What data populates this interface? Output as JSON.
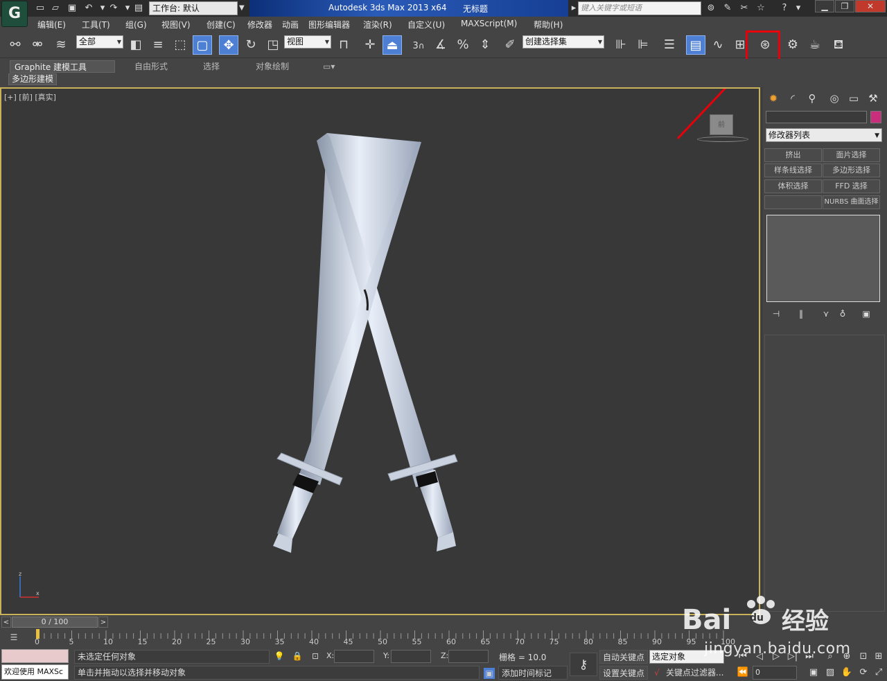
{
  "titlebar": {
    "app_logo": "G",
    "workspace": "工作台: 默认",
    "app_title": "Autodesk 3ds Max  2013 x64",
    "doc_title": "无标题",
    "search_placeholder": "键入关键字或短语",
    "icons": [
      "new-file-icon",
      "open-file-icon",
      "save-icon",
      "undo-icon",
      "redo-icon",
      "project-folder-icon"
    ]
  },
  "menu": {
    "items": [
      "编辑(E)",
      "工具(T)",
      "组(G)",
      "视图(V)",
      "创建(C)",
      "修改器",
      "动画",
      "图形编辑器",
      "渲染(R)",
      "自定义(U)",
      "MAXScript(M)",
      "帮助(H)"
    ]
  },
  "toolbar": {
    "selection_filter": "全部",
    "ref_coord": "视图",
    "snap_3": "3",
    "named_selection": "创建选择集",
    "highlighted_tool": "render-setup-icon"
  },
  "ribbon": {
    "tabs": [
      "Graphite 建模工具",
      "自由形式",
      "选择",
      "对象绘制"
    ],
    "sub_label": "多边形建模"
  },
  "viewport": {
    "label": "[+] [前] [真实]",
    "viewcube_label": "前",
    "background": "#383838",
    "border_color": "#c9b25a",
    "annotation_color": "#e8000a"
  },
  "command_panel": {
    "modifier_list": "修改器列表",
    "object_color": "#c92d7c",
    "buttons": [
      "挤出",
      "面片选择",
      "样条线选择",
      "多边形选择",
      "体积选择",
      "FFD 选择",
      "",
      "NURBS 曲面选择"
    ]
  },
  "timeline": {
    "slider_text": "0 / 100",
    "ticks": [
      "0",
      "5",
      "10",
      "15",
      "20",
      "25",
      "30",
      "35",
      "40",
      "45",
      "50",
      "55",
      "60",
      "65",
      "70",
      "75",
      "80",
      "85",
      "90",
      "95",
      "100"
    ]
  },
  "status": {
    "welcome": "欢迎使用 MAXSc",
    "line1": "未选定任何对象",
    "line2": "单击并拖动以选择并移动对象",
    "x_label": "X:",
    "y_label": "Y:",
    "z_label": "Z:",
    "grid": "栅格 = 10.0",
    "add_time_tag": "添加时间标记",
    "auto_key": "自动关键点",
    "set_key": "设置关键点",
    "selected_set": "选定对象",
    "key_filters": "关键点过滤器...",
    "frame": "0"
  },
  "watermark": {
    "brand": "Bai",
    "brand2": "du",
    "brand_cn": "经验",
    "url": "jingyan.baidu.com"
  }
}
